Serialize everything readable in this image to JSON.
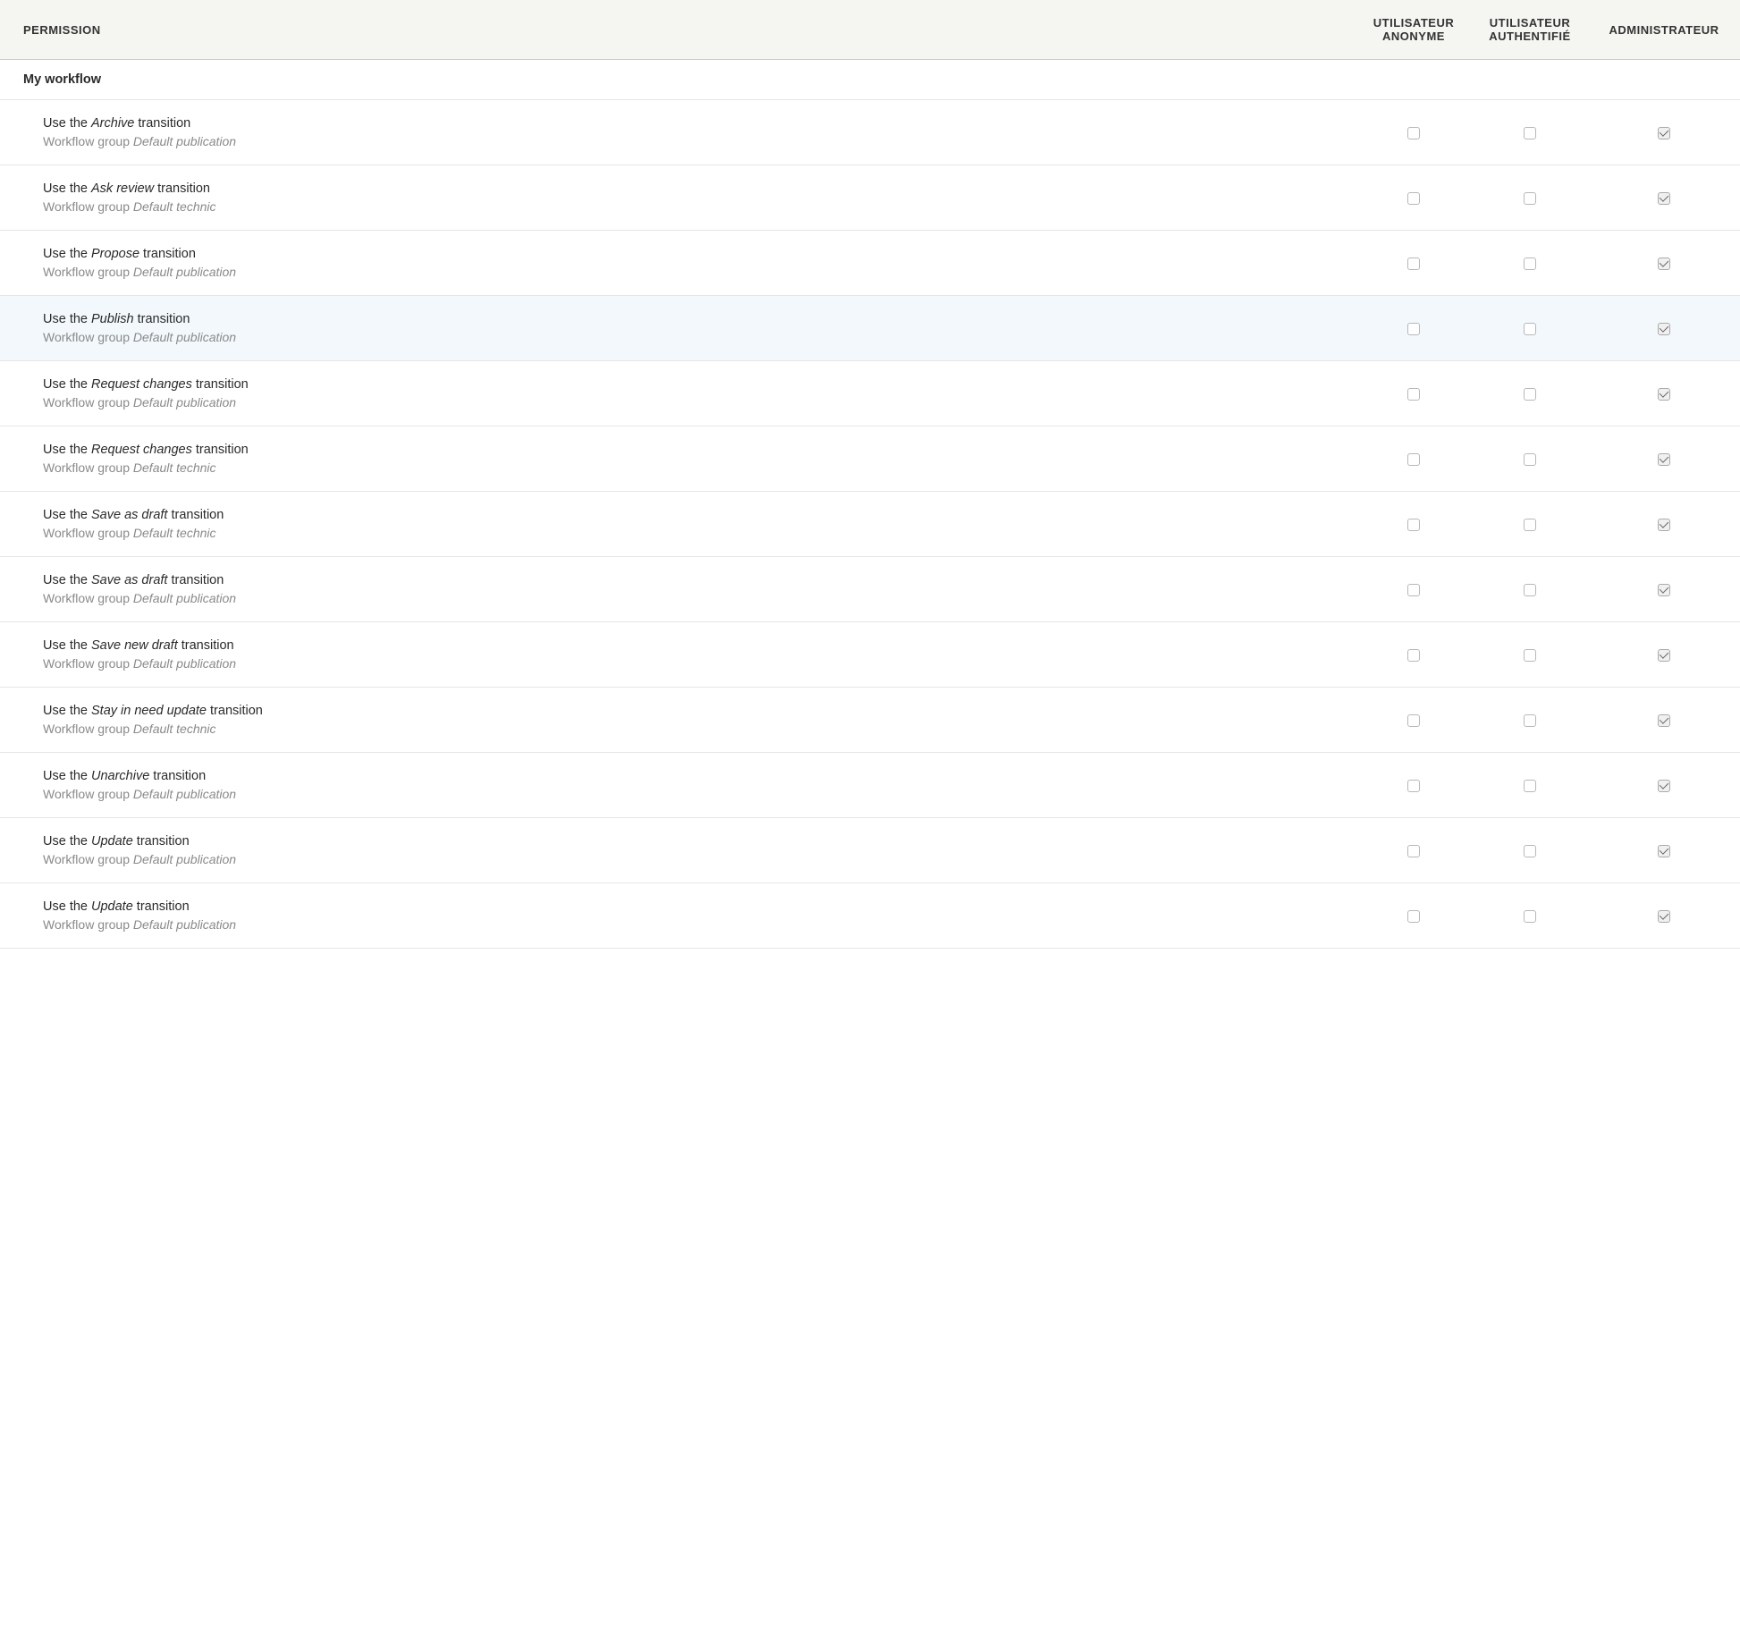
{
  "header": {
    "permission_label": "PERMISSION",
    "roles": [
      "UTILISATEUR ANONYME",
      "UTILISATEUR AUTHENTIFIÉ",
      "ADMINISTRATEUR"
    ]
  },
  "section_title": "My workflow",
  "text": {
    "use_the": "Use the ",
    "transition_suffix": " transition",
    "workflow_group": "Workflow group "
  },
  "permissions": [
    {
      "transition": "Archive",
      "group": "Default publication",
      "checks": [
        false,
        false,
        true
      ],
      "highlighted": false
    },
    {
      "transition": "Ask review",
      "group": "Default technic",
      "checks": [
        false,
        false,
        true
      ],
      "highlighted": false
    },
    {
      "transition": "Propose",
      "group": "Default publication",
      "checks": [
        false,
        false,
        true
      ],
      "highlighted": false
    },
    {
      "transition": "Publish",
      "group": "Default publication",
      "checks": [
        false,
        false,
        true
      ],
      "highlighted": true
    },
    {
      "transition": "Request changes",
      "group": "Default publication",
      "checks": [
        false,
        false,
        true
      ],
      "highlighted": false
    },
    {
      "transition": "Request changes",
      "group": "Default technic",
      "checks": [
        false,
        false,
        true
      ],
      "highlighted": false
    },
    {
      "transition": "Save as draft",
      "group": "Default technic",
      "checks": [
        false,
        false,
        true
      ],
      "highlighted": false
    },
    {
      "transition": "Save as draft",
      "group": "Default publication",
      "checks": [
        false,
        false,
        true
      ],
      "highlighted": false
    },
    {
      "transition": "Save new draft",
      "group": "Default publication",
      "checks": [
        false,
        false,
        true
      ],
      "highlighted": false
    },
    {
      "transition": "Stay in need update",
      "group": "Default technic",
      "checks": [
        false,
        false,
        true
      ],
      "highlighted": false
    },
    {
      "transition": "Unarchive",
      "group": "Default publication",
      "checks": [
        false,
        false,
        true
      ],
      "highlighted": false
    },
    {
      "transition": "Update",
      "group": "Default publication",
      "checks": [
        false,
        false,
        true
      ],
      "highlighted": false
    },
    {
      "transition": "Update",
      "group": "Default publication",
      "checks": [
        false,
        false,
        true
      ],
      "highlighted": false
    }
  ]
}
